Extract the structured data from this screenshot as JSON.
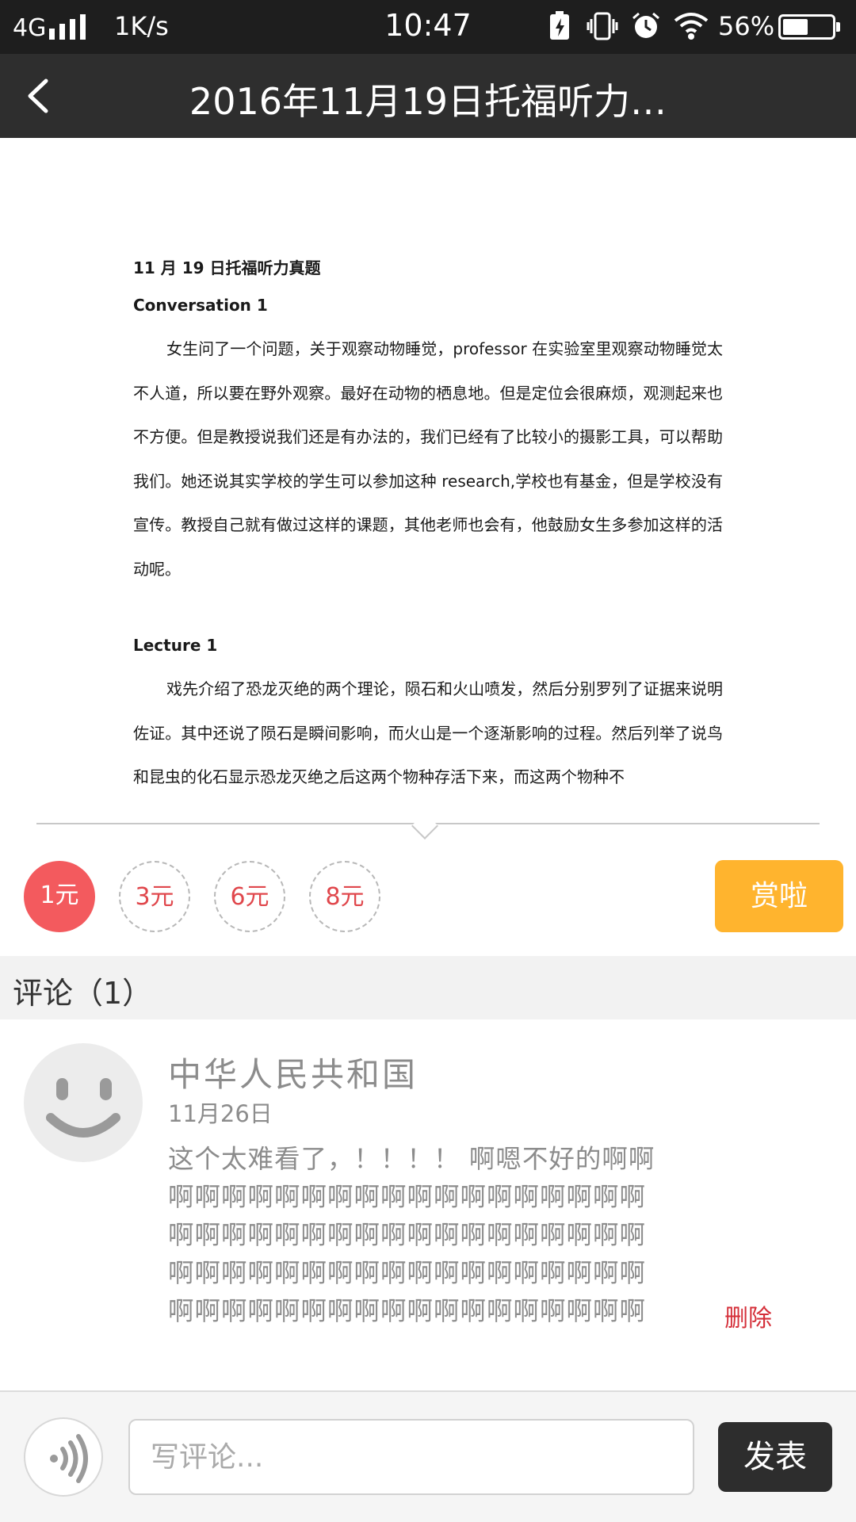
{
  "status_bar": {
    "network": "4G",
    "speed": "1K/s",
    "time": "10:47",
    "battery_percent": "56%",
    "battery_level": 0.56,
    "icons": [
      "signal-icon",
      "charging-icon",
      "vibrate-icon",
      "alarm-icon",
      "wifi-icon",
      "battery-icon"
    ]
  },
  "header": {
    "title": "2016年11月19日托福听力…",
    "back_icon": "chevron-left-icon"
  },
  "document": {
    "heading": "11 月 19 日托福听力真题",
    "sections": [
      {
        "title": "Conversation 1",
        "text": "女生问了一个问题，关于观察动物睡觉，professor 在实验室里观察动物睡觉太不人道，所以要在野外观察。最好在动物的栖息地。但是定位会很麻烦，观测起来也不方便。但是教授说我们还是有办法的，我们已经有了比较小的摄影工具，可以帮助我们。她还说其实学校的学生可以参加这种 research,学校也有基金，但是学校没有宣传。教授自己就有做过这样的课题，其他老师也会有，他鼓励女生多参加这样的活动呢。"
      },
      {
        "title": "Lecture 1",
        "text": "戏先介绍了恐龙灭绝的两个理论，陨石和火山喷发，然后分别罗列了证据来说明佐证。其中还说了陨石是瞬间影响，而火山是一个逐渐影响的过程。然后列举了说鸟和昆虫的化石显示恐龙灭绝之后这两个物种存活下来，而这两个物种不"
      }
    ]
  },
  "rewards": {
    "options": [
      "1元",
      "3元",
      "6元",
      "8元"
    ],
    "selected_index": 0,
    "submit_label": "赏啦"
  },
  "comments": {
    "header": "评论（1）",
    "items": [
      {
        "author": "中华人民共和国",
        "date": "11月26日",
        "text": "这个太难看了，！！！！ 啊嗯不好的啊啊啊啊啊啊啊啊啊啊啊啊啊啊啊啊啊啊啊啊啊啊啊啊啊啊啊啊啊啊啊啊啊啊啊啊啊啊啊啊啊啊啊啊啊啊啊啊啊啊啊啊啊啊啊啊啊啊啊啊啊啊啊啊啊啊啊啊啊啊啊啊啊啊",
        "delete_label": "删除"
      }
    ]
  },
  "input_bar": {
    "placeholder": "写评论...",
    "value": "",
    "send_label": "发表",
    "voice_icon": "voice-icon"
  },
  "colors": {
    "status_bar": "#1e1e1e",
    "header": "#2e2e2e",
    "reward_active": "#f35a5e",
    "reward_text": "#e0474c",
    "tip_button": "#ffb42e",
    "delete": "#d52f39",
    "send_button": "#2d2d2d"
  }
}
